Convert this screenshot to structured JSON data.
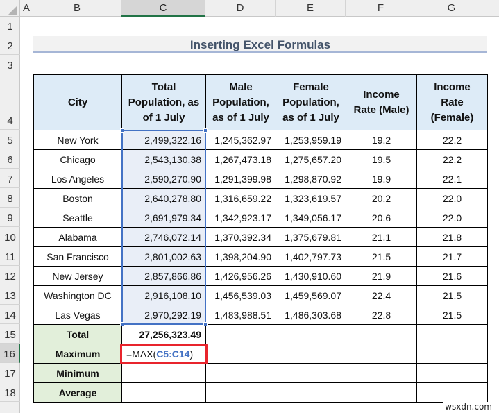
{
  "columns": [
    "A",
    "B",
    "C",
    "D",
    "E",
    "F",
    "G"
  ],
  "active_column": "C",
  "rows": [
    "1",
    "2",
    "3",
    "4",
    "5",
    "6",
    "7",
    "8",
    "9",
    "10",
    "11",
    "12",
    "13",
    "14",
    "15",
    "16",
    "17",
    "18"
  ],
  "active_row": "16",
  "title": "Inserting Excel Formulas",
  "table": {
    "headers": [
      "City",
      "Total Population, as of 1 July",
      "Male Population, as of 1 July",
      "Female Population, as of 1 July",
      "Income Rate (Male)",
      "Income Rate (Female)"
    ],
    "rows": [
      {
        "city": "New York",
        "total": "2,499,322.16",
        "male": "1,245,362.97",
        "female": "1,253,959.19",
        "rate_m": "19.2",
        "rate_f": "22.2"
      },
      {
        "city": "Chicago",
        "total": "2,543,130.38",
        "male": "1,267,473.18",
        "female": "1,275,657.20",
        "rate_m": "19.5",
        "rate_f": "22.2"
      },
      {
        "city": "Los Angeles",
        "total": "2,590,270.90",
        "male": "1,291,399.98",
        "female": "1,298,870.92",
        "rate_m": "19.9",
        "rate_f": "22.1"
      },
      {
        "city": "Boston",
        "total": "2,640,278.80",
        "male": "1,316,659.22",
        "female": "1,323,619.57",
        "rate_m": "20.2",
        "rate_f": "22.0"
      },
      {
        "city": "Seattle",
        "total": "2,691,979.34",
        "male": "1,342,923.17",
        "female": "1,349,056.17",
        "rate_m": "20.6",
        "rate_f": "22.0"
      },
      {
        "city": "Alabama",
        "total": "2,746,072.14",
        "male": "1,370,392.34",
        "female": "1,375,679.81",
        "rate_m": "21.1",
        "rate_f": "21.8"
      },
      {
        "city": "San Francisco",
        "total": "2,801,002.63",
        "male": "1,398,204.90",
        "female": "1,402,797.73",
        "rate_m": "21.5",
        "rate_f": "21.7"
      },
      {
        "city": "New Jersey",
        "total": "2,857,866.86",
        "male": "1,426,956.26",
        "female": "1,430,910.60",
        "rate_m": "21.9",
        "rate_f": "21.6"
      },
      {
        "city": "Washington DC",
        "total": "2,916,108.10",
        "male": "1,456,539.03",
        "female": "1,459,569.07",
        "rate_m": "22.4",
        "rate_f": "21.5"
      },
      {
        "city": "Las Vegas",
        "total": "2,970,292.19",
        "male": "1,483,988.51",
        "female": "1,486,303.68",
        "rate_m": "22.8",
        "rate_f": "21.5"
      }
    ],
    "summary": [
      {
        "label": "Total",
        "value": "27,256,323.49"
      },
      {
        "label": "Maximum",
        "formula_prefix": "=MAX(",
        "formula_ref": "C5:C14",
        "formula_suffix": ")"
      },
      {
        "label": "Minimum",
        "value": ""
      },
      {
        "label": "Average",
        "value": ""
      }
    ]
  },
  "colors": {
    "header_fill": "#ddebf7",
    "label_fill": "#e2efda",
    "selection": "#4472c4",
    "edit_highlight": "#e8242c",
    "title_text": "#44546a",
    "excel_green": "#217346"
  },
  "watermark": "wsxdn.com"
}
